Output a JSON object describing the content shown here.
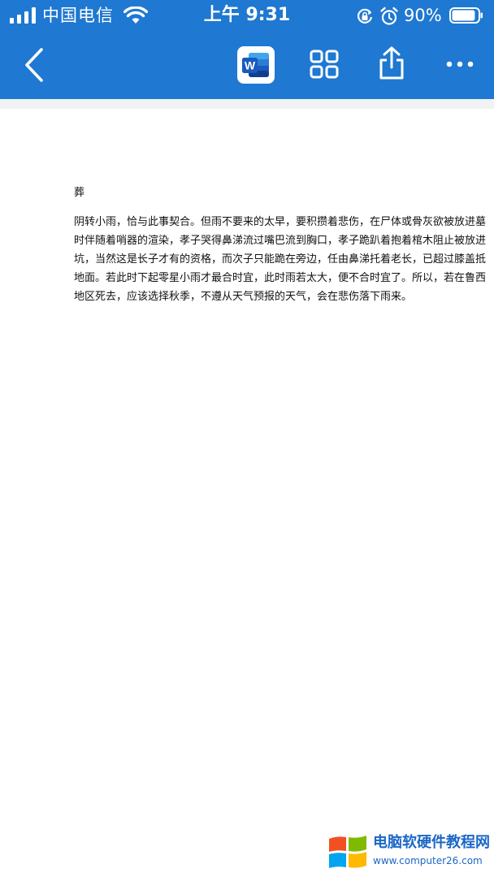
{
  "status_bar": {
    "carrier": "中国电信",
    "time": "上午 9:31",
    "battery_percent": "90%",
    "battery_level": 0.9,
    "icons": [
      "signal-icon",
      "wifi-icon",
      "rotation-lock-icon",
      "alarm-icon",
      "battery-icon"
    ]
  },
  "toolbar": {
    "icons": [
      "back-chevron-icon",
      "word-app-icon",
      "grid-icon",
      "share-icon",
      "more-icon"
    ],
    "word_letter": "W"
  },
  "document": {
    "title": "葬",
    "lines": [
      "阴转小雨，恰与此事契合。但雨不要来的太早，要积攒着悲伤，在尸体或骨灰欲被放进墓",
      "时伴随着哨器的渲染，孝子哭得鼻涕流过嘴巴流到胸口，孝子跪趴着抱着棺木阻止被放进",
      "坑，当然这是长子才有的资格，而次子只能跪在旁边，任由鼻涕托着老长，已超过膝盖抵",
      "地面。若此时下起零星小雨才最合时宜，此时雨若太大，便不合时宜了。所以，若在鲁西",
      "地区死去，应该选择秋季，不遵从天气预报的天气，会在悲伤落下雨来。"
    ]
  },
  "watermark": {
    "name": "电脑软硬件教程网",
    "url": "www.computer26.com",
    "colors": {
      "red": "#f25022",
      "green": "#7fba00",
      "blue": "#00a4ef",
      "yellow": "#ffb900",
      "text": "#1b67c7"
    }
  },
  "colors": {
    "header_blue": "#1f78d1",
    "word_blue": "#185abd",
    "page_white": "#ffffff",
    "gutter_gray": "#f1f2f3"
  }
}
